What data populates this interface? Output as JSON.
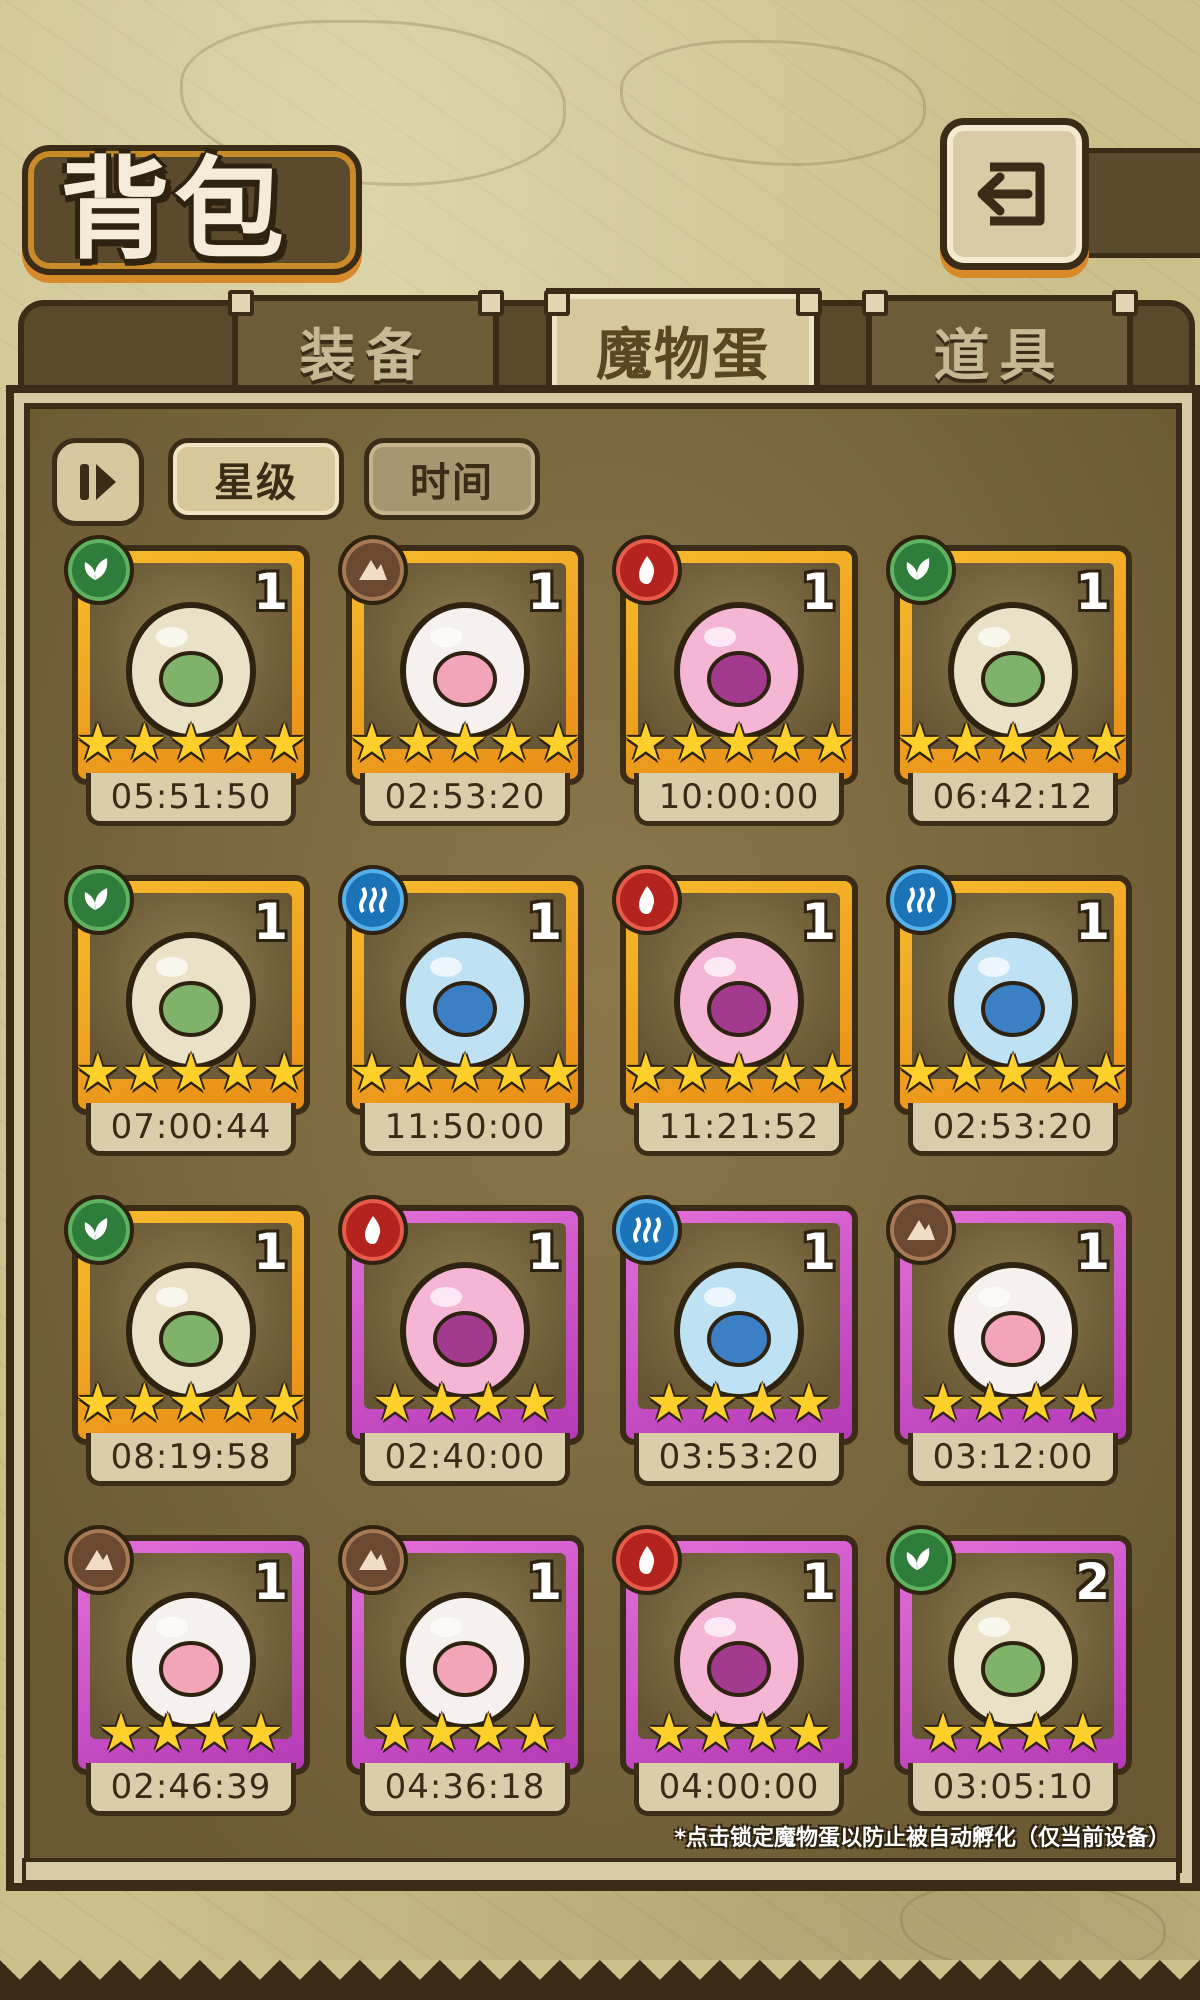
{
  "header": {
    "title": "背包"
  },
  "tabs": [
    {
      "label": "装备",
      "active": false
    },
    {
      "label": "魔物蛋",
      "active": true
    },
    {
      "label": "道具",
      "active": false
    }
  ],
  "sort": {
    "options": [
      "星级",
      "时间"
    ],
    "selected": "星级"
  },
  "eggs": [
    {
      "element": "leaf",
      "frame": "gold",
      "count": "1",
      "stars": 5,
      "timer": "05:51:50",
      "icon": "lantern-egg-icon"
    },
    {
      "element": "earth",
      "frame": "gold",
      "count": "1",
      "stars": 5,
      "timer": "02:53:20",
      "icon": "pink-heart-egg-icon"
    },
    {
      "element": "fire",
      "frame": "gold",
      "count": "1",
      "stars": 5,
      "timer": "10:00:00",
      "icon": "cake-hat-egg-icon"
    },
    {
      "element": "leaf",
      "frame": "gold",
      "count": "1",
      "stars": 5,
      "timer": "06:42:12",
      "icon": "mint-leaf-egg-icon"
    },
    {
      "element": "leaf",
      "frame": "gold",
      "count": "1",
      "stars": 5,
      "timer": "07:00:44",
      "icon": "bud-egg-icon"
    },
    {
      "element": "water",
      "frame": "gold",
      "count": "1",
      "stars": 5,
      "timer": "11:50:00",
      "icon": "shark-egg-icon"
    },
    {
      "element": "fire",
      "frame": "gold",
      "count": "1",
      "stars": 5,
      "timer": "11:21:52",
      "icon": "purple-orb-egg-icon"
    },
    {
      "element": "water",
      "frame": "gold",
      "count": "1",
      "stars": 5,
      "timer": "02:53:20",
      "icon": "blue-heart-egg-icon"
    },
    {
      "element": "leaf",
      "frame": "gold",
      "count": "1",
      "stars": 5,
      "timer": "08:19:58",
      "icon": "pocket-watch-egg-icon"
    },
    {
      "element": "fire",
      "frame": "purple",
      "count": "1",
      "stars": 4,
      "timer": "02:40:00",
      "icon": "dark-flame-egg-icon"
    },
    {
      "element": "water",
      "frame": "purple",
      "count": "1",
      "stars": 4,
      "timer": "03:53:20",
      "icon": "pudding-egg-icon"
    },
    {
      "element": "earth",
      "frame": "purple",
      "count": "1",
      "stars": 4,
      "timer": "03:12:00",
      "icon": "cracked-mask-egg-icon"
    },
    {
      "element": "earth",
      "frame": "purple",
      "count": "1",
      "stars": 4,
      "timer": "02:46:39",
      "icon": "spider-egg-icon"
    },
    {
      "element": "earth",
      "frame": "purple",
      "count": "1",
      "stars": 4,
      "timer": "04:36:18",
      "icon": "panda-egg-icon"
    },
    {
      "element": "fire",
      "frame": "purple",
      "count": "1",
      "stars": 4,
      "timer": "04:00:00",
      "icon": "pink-slime-egg-icon"
    },
    {
      "element": "leaf",
      "frame": "purple",
      "count": "2",
      "stars": 4,
      "timer": "03:05:10",
      "icon": "horned-egg-icon"
    }
  ],
  "footer_note": "*点击锁定魔物蛋以防止被自动孵化（仅当前设备）",
  "colors": {
    "gold_frame": "#f0a21f",
    "purple_frame": "#d454cf",
    "panel": "#7d6a40",
    "outline": "#3a2c17"
  }
}
